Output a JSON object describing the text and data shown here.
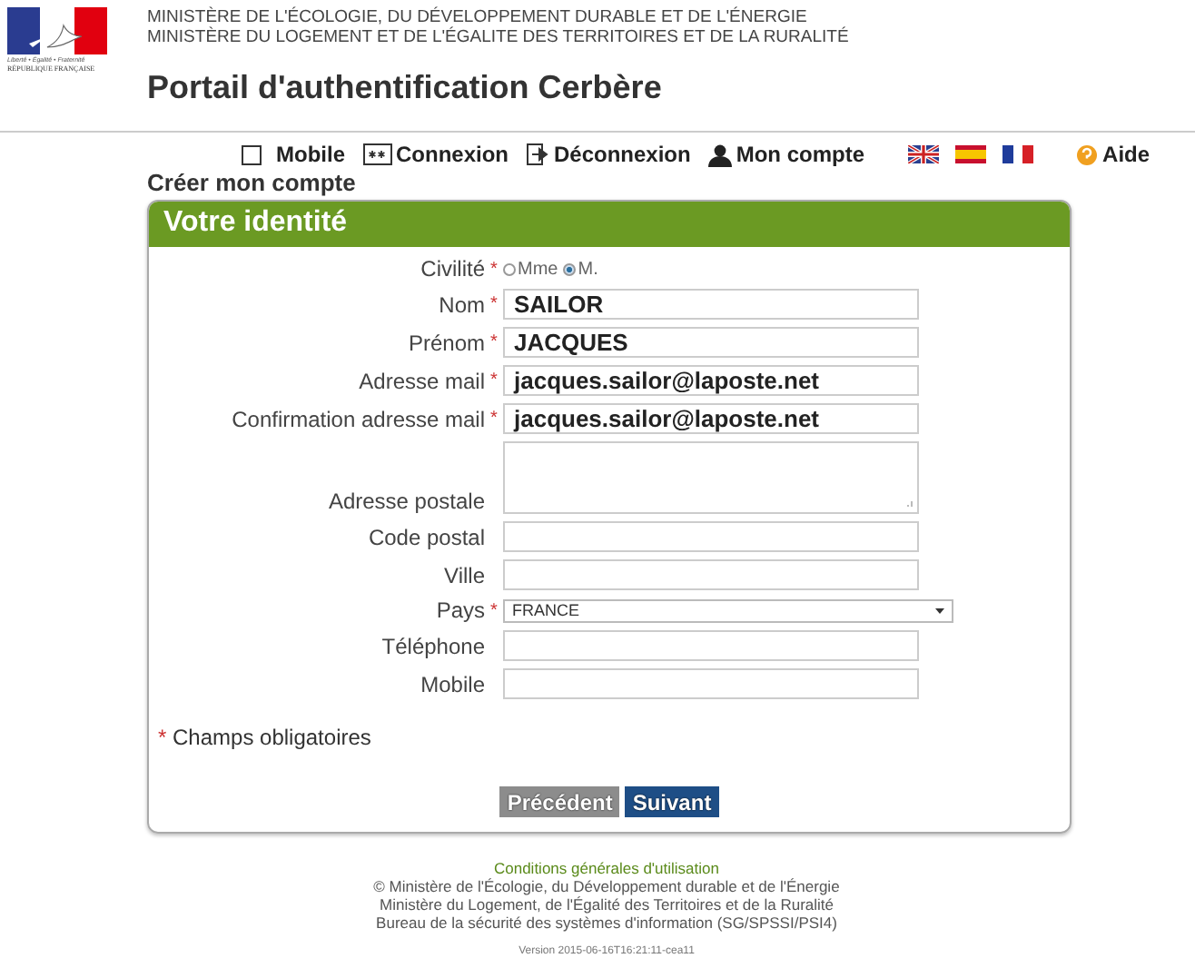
{
  "logo": {
    "motto": "Liberté • Égalité • Fraternité",
    "name": "RÉPUBLIQUE FRANÇAISE"
  },
  "header": {
    "ministries": [
      "MINISTÈRE DE L'ÉCOLOGIE, DU DÉVELOPPEMENT DURABLE ET DE L'ÉNERGIE",
      "MINISTÈRE DU LOGEMENT ET DE L'ÉGALITE DES TERRITOIRES ET DE LA RURALITÉ"
    ],
    "title": "Portail d'authentification Cerbère"
  },
  "nav": {
    "mobile_checked": false,
    "links": [
      {
        "label": "Mobile",
        "kind": "checkbox"
      },
      {
        "label": "Connexion",
        "kind": "password"
      },
      {
        "label": "Déconnexion",
        "kind": "logout"
      },
      {
        "label": "Mon compte",
        "kind": "user"
      }
    ],
    "flags": [
      {
        "kind": "uk"
      },
      {
        "kind": "es"
      },
      {
        "kind": "fr"
      }
    ],
    "help": "Aide"
  },
  "page_title": "Créer mon compte",
  "required_mark": "*",
  "panel": {
    "title": "Votre identité",
    "fields": [
      {
        "label": "Civilité",
        "required": true,
        "kind": "radio",
        "options": [
          {
            "label": "Mme",
            "selected": false
          },
          {
            "label": "M.",
            "selected": true
          }
        ]
      },
      {
        "label": "Nom",
        "required": true,
        "kind": "text",
        "value": "SAILOR"
      },
      {
        "label": "Prénom",
        "required": true,
        "kind": "text",
        "value": "JACQUES"
      },
      {
        "label": "Adresse mail",
        "required": true,
        "kind": "text",
        "value": "jacques.sailor@laposte.net"
      },
      {
        "label": "Confirmation adresse mail",
        "required": true,
        "kind": "text",
        "value": "jacques.sailor@laposte.net"
      },
      {
        "label": "Adresse postale",
        "required": false,
        "kind": "textarea"
      },
      {
        "label": "Code postal",
        "required": false,
        "kind": "text"
      },
      {
        "label": "Ville",
        "required": false,
        "kind": "text"
      },
      {
        "label": "Pays",
        "required": true,
        "kind": "select",
        "value": "FRANCE"
      },
      {
        "label": "Téléphone",
        "required": false,
        "kind": "text"
      },
      {
        "label": "Mobile",
        "required": false,
        "kind": "text"
      }
    ],
    "required_note": "Champs obligatoires",
    "buttons": [
      {
        "label": "Précédent",
        "kind": "secondary"
      },
      {
        "label": "Suivant",
        "kind": "primary"
      }
    ]
  },
  "footer": {
    "link": "Conditions générales d'utilisation",
    "lines": [
      "© Ministère de l'Écologie, du Développement durable et de l'Énergie",
      "Ministère du Logement, de l'Égalité des Territoires et de la Ruralité",
      "Bureau de la sécurité des systèmes d'information (SG/SPSSI/PSI4)"
    ],
    "version": "Version 2015-06-16T16:21:11-cea11"
  }
}
